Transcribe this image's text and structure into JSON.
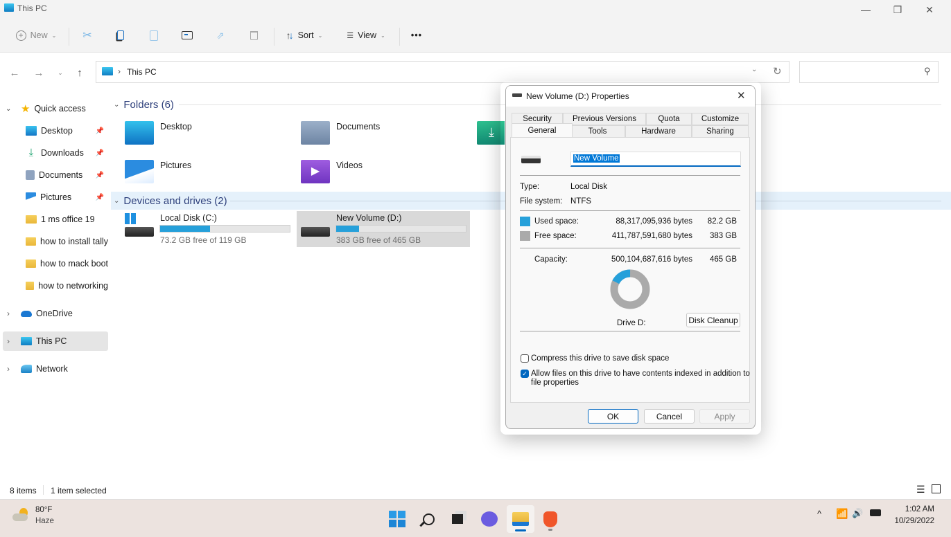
{
  "window": {
    "title": "This PC",
    "minimize": "—",
    "maximize": "❐",
    "close": "✕"
  },
  "toolbar": {
    "new_label": "New",
    "sort_label": "Sort",
    "view_label": "View",
    "more": "•••",
    "icons": [
      "cut-icon",
      "copy-icon",
      "paste-icon",
      "rename-icon",
      "share-icon",
      "delete-icon"
    ]
  },
  "address": {
    "path": [
      "This PC"
    ],
    "separator": "›",
    "search_placeholder": ""
  },
  "sidebar": {
    "quick_access": "Quick access",
    "pinned": [
      {
        "label": "Desktop",
        "icon": "desktop-icon"
      },
      {
        "label": "Downloads",
        "icon": "downloads-icon"
      },
      {
        "label": "Documents",
        "icon": "documents-icon"
      },
      {
        "label": "Pictures",
        "icon": "pictures-icon"
      }
    ],
    "recent": [
      {
        "label": "1 ms office 19"
      },
      {
        "label": "how to install tally"
      },
      {
        "label": "how to mack boot"
      },
      {
        "label": "how to networking"
      }
    ],
    "roots": [
      {
        "label": "OneDrive",
        "selected": false
      },
      {
        "label": "This PC",
        "selected": true
      },
      {
        "label": "Network",
        "selected": false
      }
    ]
  },
  "content": {
    "folders_header": "Folders (6)",
    "folders": [
      {
        "label": "Desktop"
      },
      {
        "label": "Documents"
      },
      {
        "label": "Downloads"
      },
      {
        "label": "Pictures"
      },
      {
        "label": "Videos"
      }
    ],
    "drives_header": "Devices and drives (2)",
    "drives": [
      {
        "label": "Local Disk (C:)",
        "free_text": "73.2 GB free of 119 GB",
        "used_fraction": 0.385,
        "selected": false
      },
      {
        "label": "New Volume (D:)",
        "free_text": "383 GB free of 465 GB",
        "used_fraction": 0.177,
        "selected": true
      }
    ]
  },
  "statusbar": {
    "items": "8 items",
    "selected": "1 item selected"
  },
  "dialog": {
    "title": "New Volume (D:) Properties",
    "tabs_row1": [
      "Security",
      "Previous Versions",
      "Quota",
      "Customize"
    ],
    "tabs_row2": [
      "General",
      "Tools",
      "Hardware",
      "Sharing"
    ],
    "active_tab": "General",
    "volume_name": "New Volume",
    "type_label": "Type:",
    "type_value": "Local Disk",
    "fs_label": "File system:",
    "fs_value": "NTFS",
    "used_label": "Used space:",
    "used_bytes": "88,317,095,936 bytes",
    "used_gb": "82.2 GB",
    "free_label": "Free space:",
    "free_bytes": "411,787,591,680 bytes",
    "free_gb": "383 GB",
    "capacity_label": "Capacity:",
    "capacity_bytes": "500,104,687,616 bytes",
    "capacity_gb": "465 GB",
    "used_fraction": 0.1766,
    "used_color": "#26a0da",
    "free_color": "#aaaaaa",
    "drive_label": "Drive D:",
    "disk_cleanup": "Disk Cleanup",
    "compress_label": "Compress this drive to save disk space",
    "compress_checked": false,
    "index_label_1": "Allow files on this drive to have contents indexed in addition to",
    "index_label_2": "file properties",
    "index_checked": true,
    "ok": "OK",
    "cancel": "Cancel",
    "apply": "Apply"
  },
  "taskbar": {
    "weather_temp": "80°F",
    "weather_desc": "Haze",
    "time": "1:02 AM",
    "date": "10/29/2022",
    "tray_chevron": "^"
  }
}
